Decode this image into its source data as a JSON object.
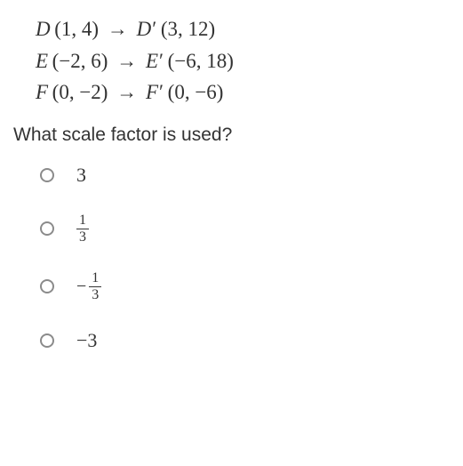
{
  "transformations": [
    {
      "p": "D",
      "c1": "(1, 4)",
      "pp": "D",
      "c2": "(3, 12)"
    },
    {
      "p": "E",
      "c1": "(−2, 6)",
      "pp": "E",
      "c2": "(−6, 18)"
    },
    {
      "p": "F",
      "c1": "(0, −2)",
      "pp": "F",
      "c2": "(0, −6)"
    }
  ],
  "arrow": "→",
  "primeMark": "′",
  "question": "What scale factor is used?",
  "options": {
    "a": "3",
    "b": {
      "num": "1",
      "den": "3"
    },
    "c": {
      "sign": "−",
      "num": "1",
      "den": "3"
    },
    "d": "−3"
  },
  "chart_data": {
    "type": "table",
    "title": "Dilation mapping and scale factor question",
    "points": [
      {
        "label": "D",
        "pre": [
          1,
          4
        ],
        "post": [
          3,
          12
        ]
      },
      {
        "label": "E",
        "pre": [
          -2,
          6
        ],
        "post": [
          -6,
          18
        ]
      },
      {
        "label": "F",
        "pre": [
          0,
          -2
        ],
        "post": [
          0,
          -6
        ]
      }
    ],
    "question": "What scale factor is used?",
    "choices": [
      "3",
      "1/3",
      "-1/3",
      "-3"
    ]
  }
}
